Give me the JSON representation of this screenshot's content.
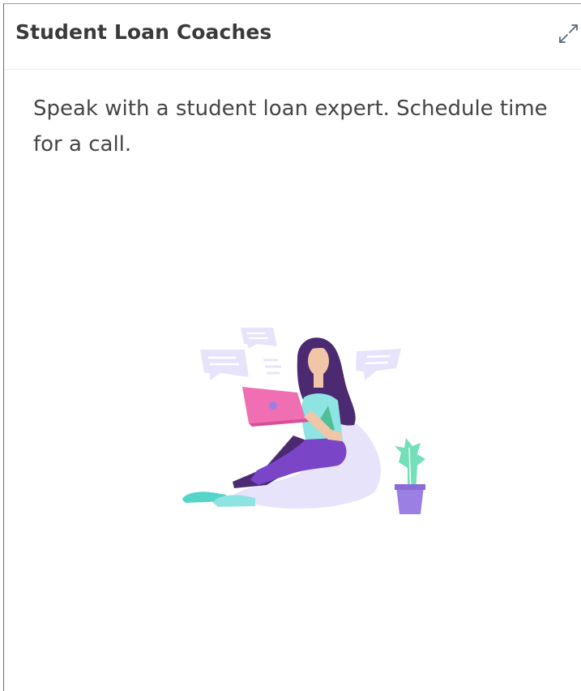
{
  "card": {
    "title": "Student Loan Coaches",
    "description": "Speak with a student loan expert. Schedule time for a call.",
    "expand_icon": "expand-arrows-icon",
    "illustration": "woman-with-laptop-illustration"
  },
  "colors": {
    "title_text": "#3a3a3a",
    "body_text": "#454545",
    "bubble": "#e7e3fb",
    "laptop": "#f06fb2",
    "hair": "#4b2a72",
    "shirt": "#8ee4e3",
    "pants": "#7b45c8",
    "shoes": "#55d4c8",
    "plant_leaf": "#73e0b9",
    "plant_pot": "#9b7fe3"
  }
}
